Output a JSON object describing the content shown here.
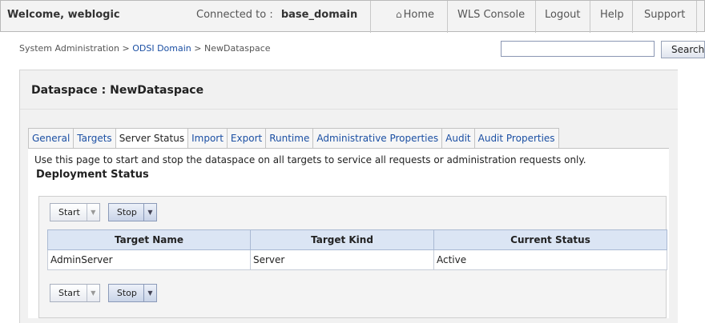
{
  "header": {
    "welcome": "Welcome, weblogic",
    "connected_label": "Connected to :",
    "domain": "base_domain",
    "links": {
      "home": "Home",
      "console": "WLS Console",
      "logout": "Logout",
      "help": "Help",
      "support": "Support"
    }
  },
  "breadcrumb": {
    "root": "System Administration",
    "sep1": " > ",
    "domain_link": "ODSI Domain",
    "sep2": " > ",
    "current": "NewDataspace"
  },
  "search": {
    "placeholder": "",
    "button": "Search"
  },
  "panel": {
    "title": "Dataspace : NewDataspace"
  },
  "tabs": [
    {
      "label": "General"
    },
    {
      "label": "Targets"
    },
    {
      "label": "Server Status"
    },
    {
      "label": "Import"
    },
    {
      "label": "Export"
    },
    {
      "label": "Runtime"
    },
    {
      "label": "Administrative Properties"
    },
    {
      "label": "Audit"
    },
    {
      "label": "Audit Properties"
    }
  ],
  "active_tab": "Server Status",
  "content": {
    "description": "Use this page to start and stop the dataspace on all targets to service all requests or administration requests only.",
    "section_title": "Deployment Status",
    "buttons": {
      "start": "Start",
      "stop": "Stop"
    }
  },
  "table": {
    "headers": [
      "Target Name",
      "Target Kind",
      "Current Status"
    ],
    "rows": [
      [
        "AdminServer",
        "Server",
        "Active"
      ]
    ]
  }
}
